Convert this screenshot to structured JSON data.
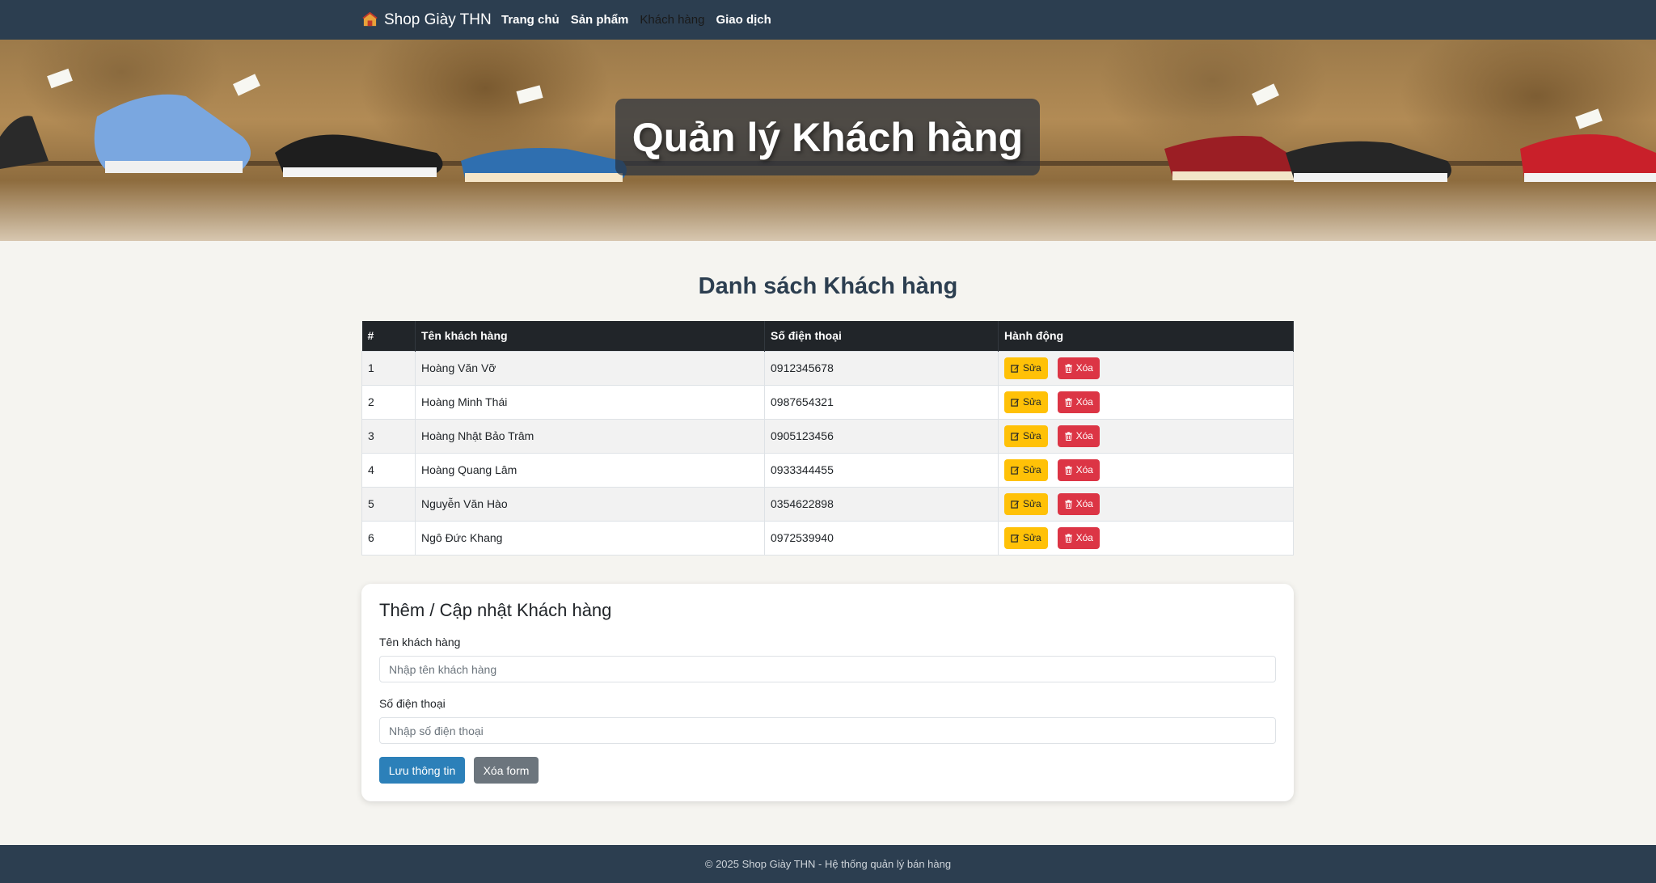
{
  "navbar": {
    "brand": "Shop Giày THN",
    "brand_icon": "store-icon",
    "links": [
      {
        "label": "Trang chủ",
        "active": false
      },
      {
        "label": "Sản phẩm",
        "active": false
      },
      {
        "label": "Khách hàng",
        "active": true
      },
      {
        "label": "Giao dịch",
        "active": false
      }
    ]
  },
  "hero": {
    "title": "Quản lý Khách hàng"
  },
  "section": {
    "title": "Danh sách Khách hàng"
  },
  "table": {
    "headers": [
      "#",
      "Tên khách hàng",
      "Số điện thoại",
      "Hành động"
    ],
    "rows": [
      {
        "idx": "1",
        "name": "Hoàng Văn Vỡ",
        "phone": "0912345678"
      },
      {
        "idx": "2",
        "name": "Hoàng Minh Thái",
        "phone": "0987654321"
      },
      {
        "idx": "3",
        "name": "Hoàng Nhật Bảo Trâm",
        "phone": "0905123456"
      },
      {
        "idx": "4",
        "name": "Hoàng Quang Lâm",
        "phone": "0933344455"
      },
      {
        "idx": "5",
        "name": "Nguyễn Văn Hào",
        "phone": "0354622898"
      },
      {
        "idx": "6",
        "name": "Ngô Đức Khang",
        "phone": "0972539940"
      }
    ],
    "edit_label": "Sửa",
    "delete_label": "Xóa"
  },
  "form": {
    "title": "Thêm / Cập nhật Khách hàng",
    "name_label": "Tên khách hàng",
    "name_placeholder": "Nhập tên khách hàng",
    "name_value": "",
    "phone_label": "Số điện thoại",
    "phone_placeholder": "Nhập số điện thoại",
    "phone_value": "",
    "save_label": "Lưu thông tin",
    "clear_label": "Xóa form"
  },
  "footer": {
    "text": "© 2025 Shop Giày THN - Hệ thống quản lý bán hàng"
  },
  "colors": {
    "navbar": "#2c3e50",
    "edit_button": "#ffc107",
    "delete_button": "#dc3545",
    "primary_button": "#2c80b9",
    "secondary_button": "#6c757d",
    "table_header": "#212529"
  }
}
